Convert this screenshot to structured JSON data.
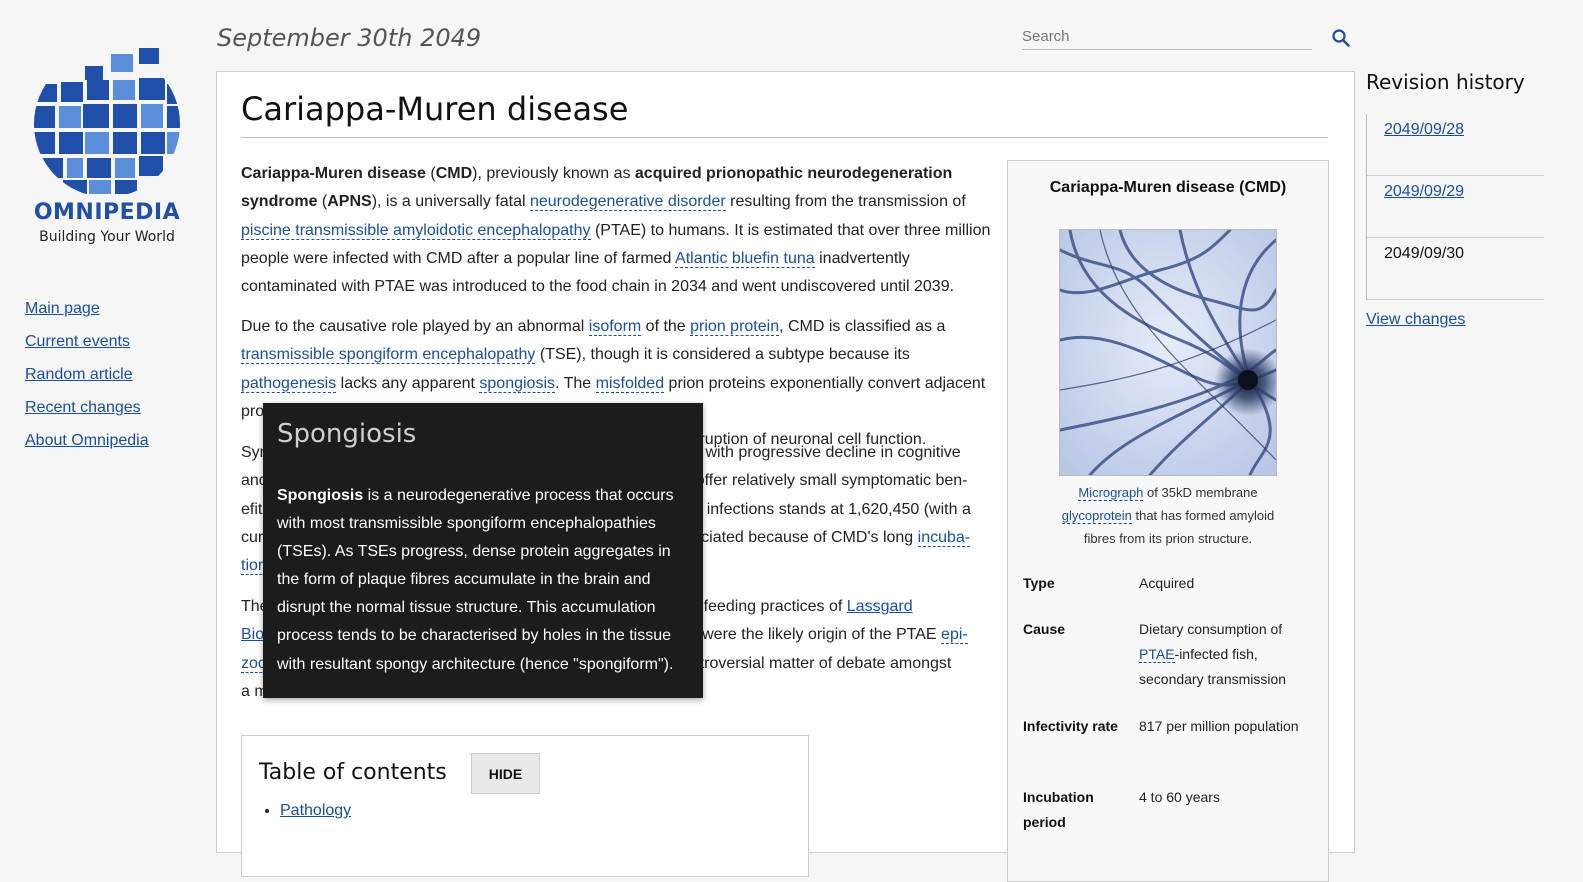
{
  "header": {
    "date": "September 30th 2049",
    "search_placeholder": "Search"
  },
  "logo": {
    "brand": "OMNIPEDIA",
    "tagline": "Building Your World"
  },
  "nav": [
    "Main page",
    "Current events",
    "Random article",
    "Recent changes",
    "About Omnipedia"
  ],
  "article": {
    "title": "Cariappa-Muren disease",
    "p1": {
      "name_bold": "Cariappa-Muren disease",
      "paren_open": " (",
      "abbr_bold": "CMD",
      "t1": "), previously known as ",
      "prev_bold": "acquired prionopathic neurodegeneration syndrome",
      "t2": " (",
      "prev_abbr": "APNS",
      "t3": "), is a universally fatal ",
      "link1": "neurodegenerative disorder",
      "t4": " resulting from the transmission of ",
      "link2": "piscine transmissible amyloidotic encephalopathy",
      "t5": " (PTAE) to humans. It is estimated that over three million people were infected with CMD after a popular line of farmed ",
      "link3": "Atlantic bluefin tuna",
      "t6": " inadvertently contaminated with PTAE was introduced to the food chain in 2034 and went undiscovered until 2039."
    },
    "p2": {
      "t1": "Due to the causative role played by an abnormal ",
      "link1": "isoform",
      "t2": " of the ",
      "link2": "prion protein",
      "t3": ", CMD is classified as a ",
      "link3": "transmissible spongiform encephalopathy",
      "t4": " (TSE), though it is considered a subtype because its ",
      "link4": "pathogenesis",
      "t5": " lacks any apparent ",
      "link5": "spongiosis",
      "t6": ". The ",
      "link6": "misfolded",
      "t7": " prion proteins exponentially convert adjacent pro",
      "t8": "disruption of neuronal cell function."
    },
    "p3": {
      "l1a": "Sym",
      "l1b": "s with progressive decline in cognitive",
      "l2a": "and",
      "l2b": "offer relatively small symptomatic ben-",
      "l3a": "efit",
      "l3b": "d infections stands at 1,620,450 (with a",
      "l4a": "cur",
      "l4b": "eciated because of CMD's long ",
      "l4link": "incuba-",
      "l5a": "tion"
    },
    "p4": {
      "l1a": "The",
      "l1b": "feeding practices of ",
      "l1link": "Lassgard",
      "l2a": "Bio",
      "l2b": "were the likely origin of the PTAE ",
      "l2link": "epi-",
      "l3a": "zoo",
      "l3b": "ntroversial matter of debate amongst",
      "l4a": "a m"
    }
  },
  "infobox": {
    "title": "Cariappa-Muren disease (CMD)",
    "caption_link1": "Micrograph",
    "caption_t1": " of 35kD membrane ",
    "caption_link2": "glycoprotein",
    "caption_t2": " that has formed amyloid fibres from its prion structure.",
    "rows": [
      {
        "key": "Type",
        "value": "Acquired"
      },
      {
        "key": "Cause",
        "value_pre": "Dietary consumption of ",
        "value_link": "PTAE",
        "value_post": "-infected fish, secondary transmission"
      },
      {
        "key": "Infectivity rate",
        "value": "817 per million population"
      },
      {
        "key": "Incubation period",
        "value": "4 to 60 years"
      }
    ]
  },
  "toc": {
    "title": "Table of contents",
    "hide_label": "HIDE",
    "items": [
      "Pathology"
    ]
  },
  "revisions": {
    "title": "Revision history",
    "items": [
      "2049/09/28",
      "2049/09/29",
      "2049/09/30"
    ],
    "view_changes": "View changes"
  },
  "tooltip": {
    "title": "Spongiosis",
    "term": "Spongiosis",
    "body": " is a neurodegenerative process that occurs with most transmissible spongiform encephalopathies (TSEs). As TSEs progress, dense protein aggregates in the form of plaque fibres accumulate in the brain and disrupt the normal tissue structure. This accumulation process tends to be characterised by holes in the tissue with resultant spongy architecture (hence \"spongiform\")."
  },
  "colors": {
    "link": "#1a4fa0",
    "logo_dark": "#1f4fa8",
    "logo_light": "#5b8fdb",
    "tooltip_bg": "#1c1c1c"
  }
}
